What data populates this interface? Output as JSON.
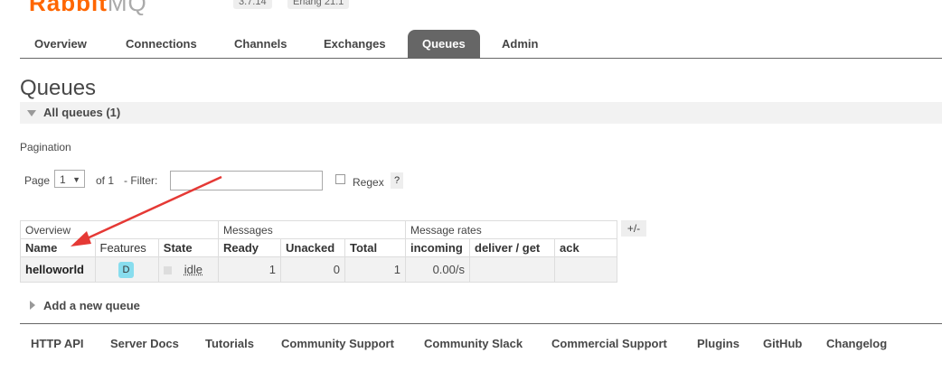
{
  "header": {
    "logo_main": "Rabbit",
    "logo_sub": "MQ",
    "version_badge": "3.7.14",
    "erlang_badge": "Erlang 21.1"
  },
  "tabs": [
    {
      "label": "Overview",
      "active": false
    },
    {
      "label": "Connections",
      "active": false
    },
    {
      "label": "Channels",
      "active": false
    },
    {
      "label": "Exchanges",
      "active": false
    },
    {
      "label": "Queues",
      "active": true
    },
    {
      "label": "Admin",
      "active": false
    }
  ],
  "page": {
    "title": "Queues",
    "section_label": "All queues (1)"
  },
  "pagination": {
    "label": "Pagination",
    "page_prefix": "Page",
    "page_value": "1",
    "of_text": "of 1",
    "filter_label": "- Filter:",
    "filter_value": "",
    "regex_label": "Regex",
    "help_label": "?"
  },
  "table": {
    "group_headers": {
      "overview": "Overview",
      "messages": "Messages",
      "rates": "Message rates"
    },
    "columns": [
      "Name",
      "Features",
      "State",
      "Ready",
      "Unacked",
      "Total",
      "incoming",
      "deliver / get",
      "ack"
    ],
    "rows": [
      {
        "name": "helloworld",
        "feature": "D",
        "state": "idle",
        "ready": "1",
        "unacked": "0",
        "total": "1",
        "incoming": "0.00/s",
        "deliver_get": "",
        "ack": ""
      }
    ],
    "toggle_columns": "+/-"
  },
  "add_queue": "Add a new queue",
  "footer": {
    "links": [
      "HTTP API",
      "Server Docs",
      "Tutorials",
      "Community Support",
      "Community Slack",
      "Commercial Support",
      "Plugins",
      "GitHub",
      "Changelog"
    ]
  },
  "colors": {
    "accent": "#ff6600",
    "active_tab": "#666666",
    "arrow": "#e53935",
    "badge": "#88ddee"
  }
}
